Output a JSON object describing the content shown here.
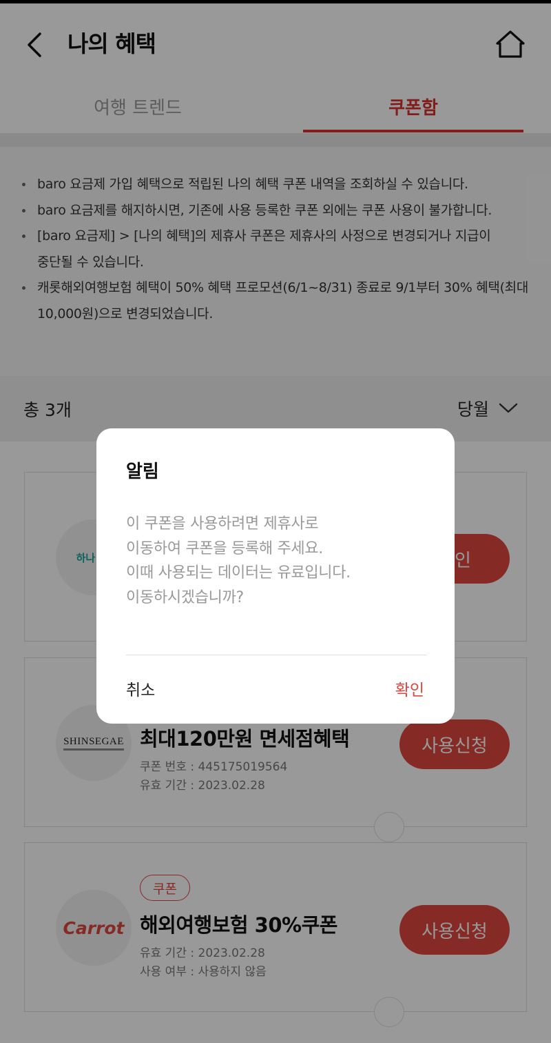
{
  "header": {
    "title": "나의 혜택"
  },
  "tabs": [
    {
      "label": "여행 트렌드",
      "active": false
    },
    {
      "label": "쿠폰함",
      "active": true
    }
  ],
  "notice": {
    "items": [
      "baro 요금제 가입 혜택으로 적립된 나의 혜택 쿠폰 내역을 조회하실 수 있습니다.",
      "baro 요금제를 해지하시면, 기존에 사용 등록한 쿠폰 외에는 쿠폰 사용이 불가합니다.",
      "[baro 요금제] > [나의 혜택]의 제휴사 쿠폰은 제휴사의 사정으로 변경되거나 지급이 중단될 수 있습니다.",
      "캐롯해외여행보험 혜택이 50% 혜택 프로모션(6/1~8/31) 종료로 9/1부터 30% 혜택(최대 10,000원)으로 변경되었습니다."
    ]
  },
  "list": {
    "count_text": "총 3개",
    "period": "당월"
  },
  "coupons": [
    {
      "logo_text": "하나1Q",
      "action": "확인"
    },
    {
      "logo_text": "SHINSEGAE",
      "title": "최대120만원 면세점혜택",
      "meta1": "쿠폰 번호 : 445175019564",
      "meta2": "유효 기간 : 2023.02.28",
      "action": "사용신청"
    },
    {
      "logo_text": "Carrot",
      "badge": "쿠폰",
      "title": "해외여행보험 30%쿠폰",
      "meta1": "유효 기간 : 2023.02.28",
      "meta2": "사용 여부 : 사용하지 않음",
      "action": "사용신청"
    }
  ],
  "dialog": {
    "title": "알림",
    "lines": [
      "이 쿠폰을 사용하려면 제휴사로",
      "이동하여 쿠폰을 등록해 주세요.",
      "이때 사용되는 데이터는 유료입니다.",
      "이동하시겠습니까?"
    ],
    "cancel": "취소",
    "confirm": "확인"
  },
  "colors": {
    "accent": "#d8322f",
    "button": "#e0463f",
    "overlay": "rgba(0,0,0,0.4)"
  }
}
